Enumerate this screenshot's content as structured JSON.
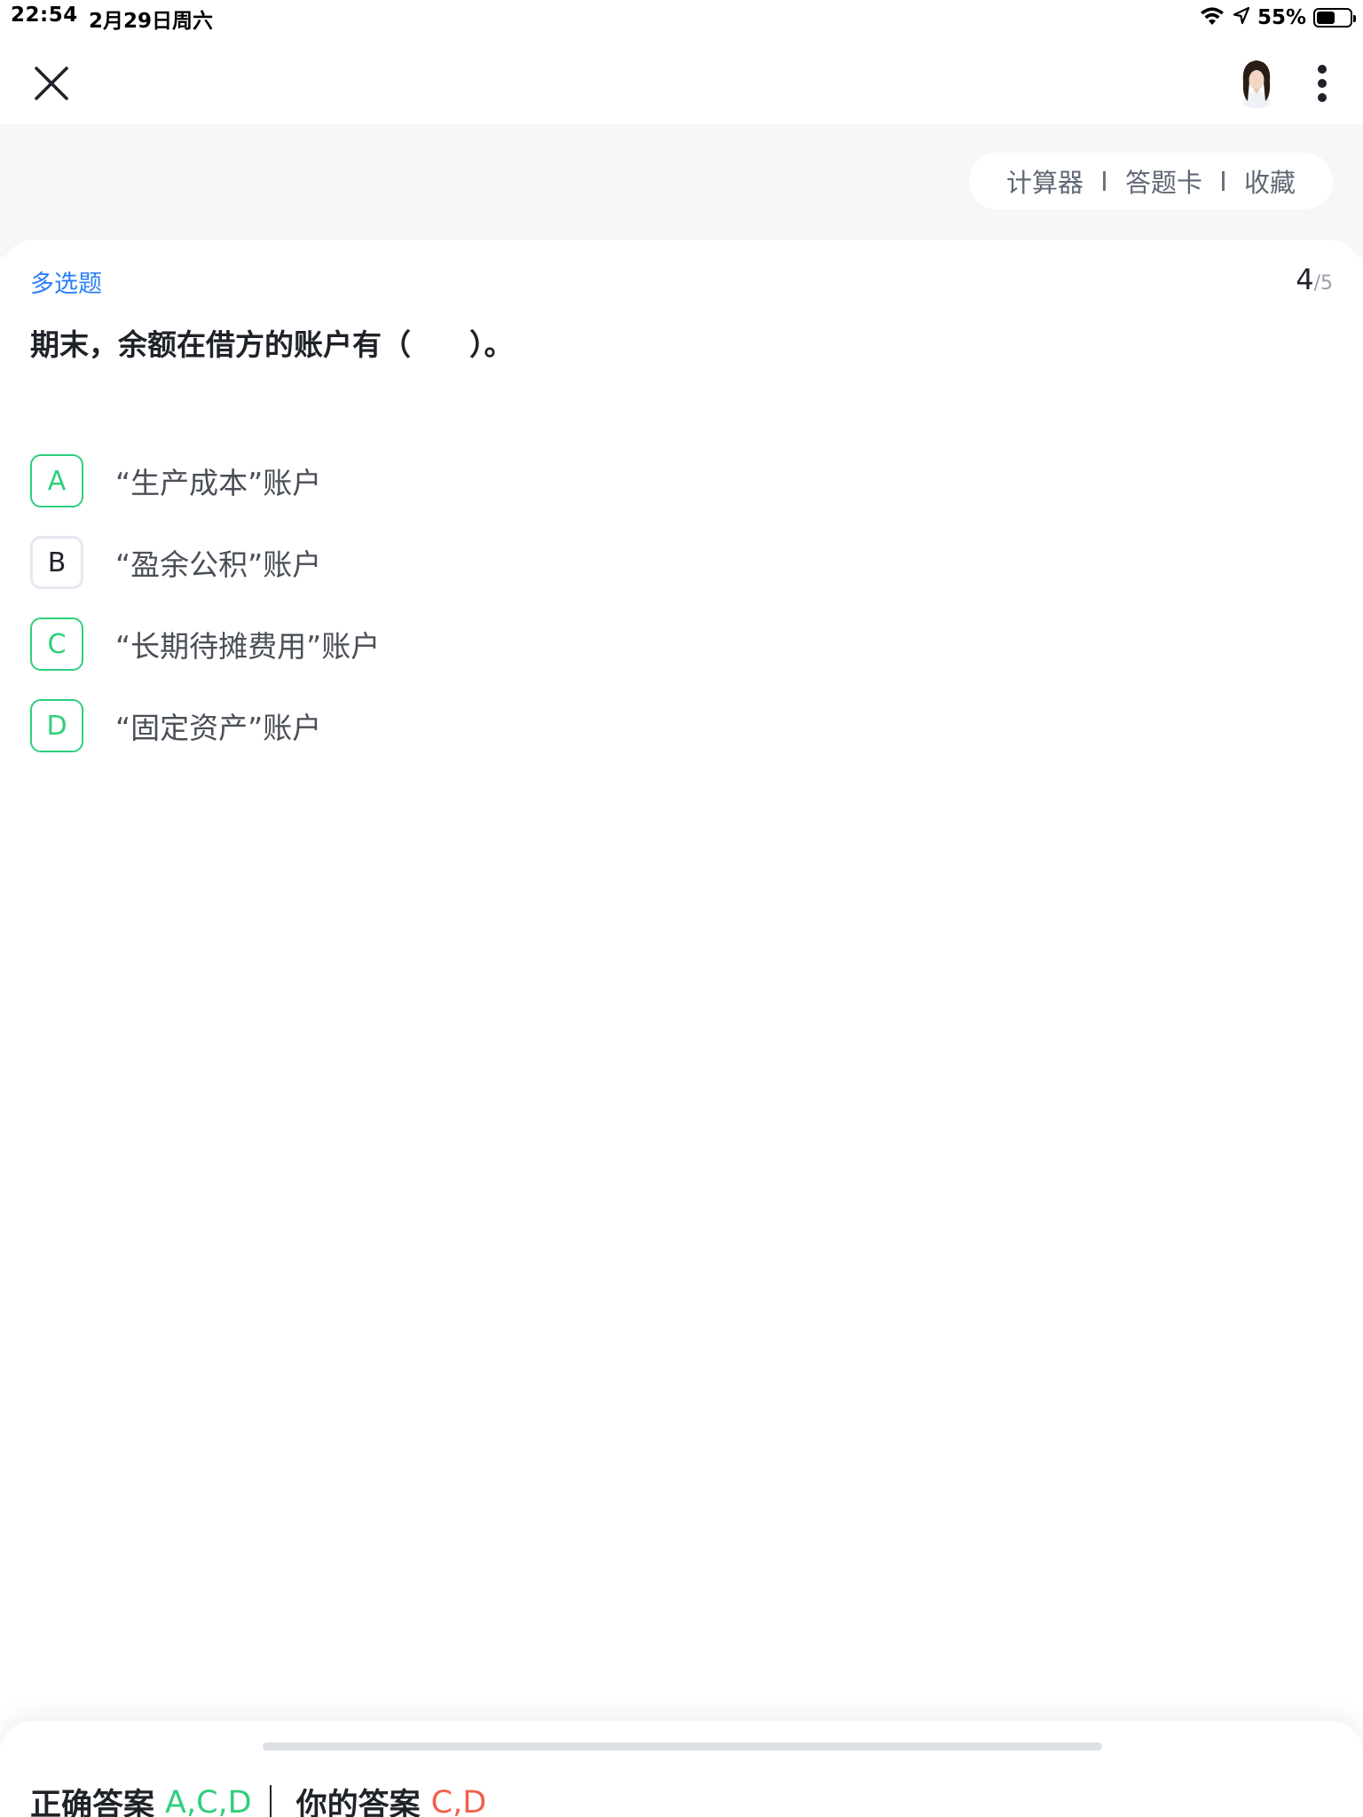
{
  "status_bar": {
    "time": "22:54",
    "date": "2月29日周六",
    "battery_percent": "55%",
    "battery_level": 0.55,
    "icons": [
      "wifi-icon",
      "location-icon",
      "battery-icon"
    ]
  },
  "nav": {
    "icons": [
      "close-icon",
      "avatar",
      "more-vertical-icon"
    ]
  },
  "tools": {
    "calculator": "计算器",
    "answer_card": "答题卡",
    "favorite": "收藏"
  },
  "question": {
    "type": "多选题",
    "current": "4",
    "total": "/5",
    "stem": "期末，余额在借方的账户有（　　）。",
    "options": [
      {
        "letter": "A",
        "text": "“生产成本”账户",
        "selected": true
      },
      {
        "letter": "B",
        "text": "“盈余公积”账户",
        "selected": false
      },
      {
        "letter": "C",
        "text": "“长期待摊费用”账户",
        "selected": true
      },
      {
        "letter": "D",
        "text": "“固定资产”账户",
        "selected": true
      }
    ]
  },
  "answer": {
    "correct_label": "正确答案",
    "correct_value": "A,C,D",
    "yours_label": "你的答案",
    "yours_value": "C,D"
  },
  "colors": {
    "accent_blue": "#2d7ff9",
    "correct_green": "#2ecf7b",
    "wrong_red": "#f0604d",
    "band_gray": "#f6f7f9"
  }
}
